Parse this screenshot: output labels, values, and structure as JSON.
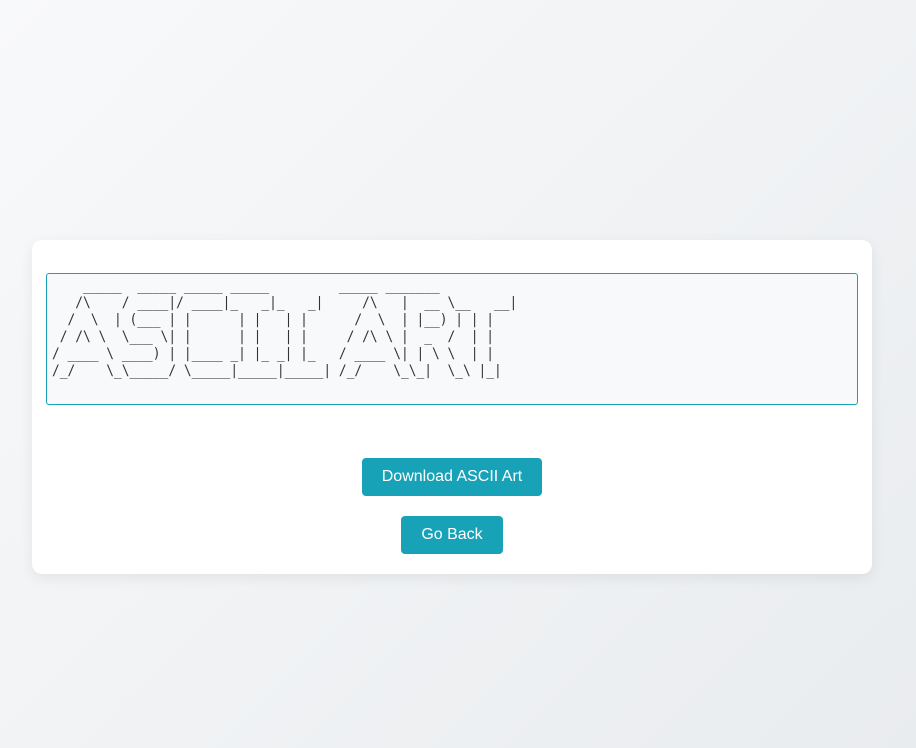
{
  "ascii_art": {
    "text": "    _____  _____ _____ _____         _____ _______ \n   /\\    / ____|/ ____|_   _|_   _|     /\\   |  __ \\__   __|\n  /  \\  | (___ | |      | |   | |      /  \\  | |__) | | |   \n / /\\ \\  \\___ \\| |      | |   | |     / /\\ \\ |  _  /  | |   \n/ ____ \\ ____) | |____ _| |_ _| |_   / ____ \\| | \\ \\  | |   \n/_/    \\_\\_____/ \\_____|_____|_____| /_/    \\_\\_|  \\_\\ |_|   "
  },
  "actions": {
    "download_label": "Download ASCII Art",
    "back_label": "Go Back"
  },
  "colors": {
    "accent": "#17a2b8",
    "background": "#e9ecef",
    "card": "#ffffff"
  }
}
